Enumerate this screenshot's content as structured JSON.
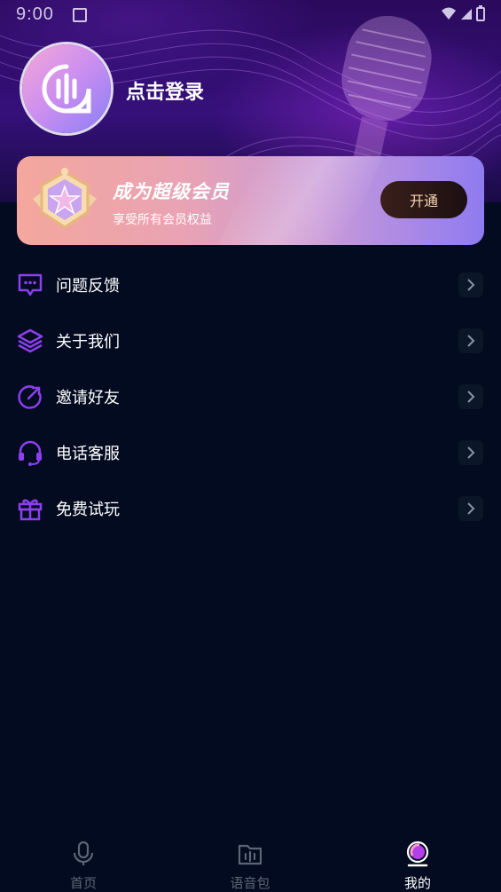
{
  "status_bar": {
    "time": "9:00"
  },
  "profile": {
    "login_prompt": "点击登录"
  },
  "vip": {
    "title": "成为超级会员",
    "subtitle": "享受所有会员权益",
    "button_label": "开通"
  },
  "menu": {
    "items": [
      {
        "label": "问题反馈",
        "icon": "feedback-message-icon"
      },
      {
        "label": "关于我们",
        "icon": "layers-icon"
      },
      {
        "label": "邀请好友",
        "icon": "invite-arrow-icon"
      },
      {
        "label": "电话客服",
        "icon": "headset-icon"
      },
      {
        "label": "免费试玩",
        "icon": "gift-icon"
      }
    ]
  },
  "tab_bar": {
    "tabs": [
      {
        "label": "首页",
        "icon": "microphone-icon",
        "active": false
      },
      {
        "label": "语音包",
        "icon": "voice-folder-icon",
        "active": false
      },
      {
        "label": "我的",
        "icon": "profile-orb-icon",
        "active": true
      }
    ]
  },
  "colors": {
    "background": "#020b1f",
    "accent_purple": "#8b3ff0",
    "vip_button_text": "#f6d8b5"
  }
}
